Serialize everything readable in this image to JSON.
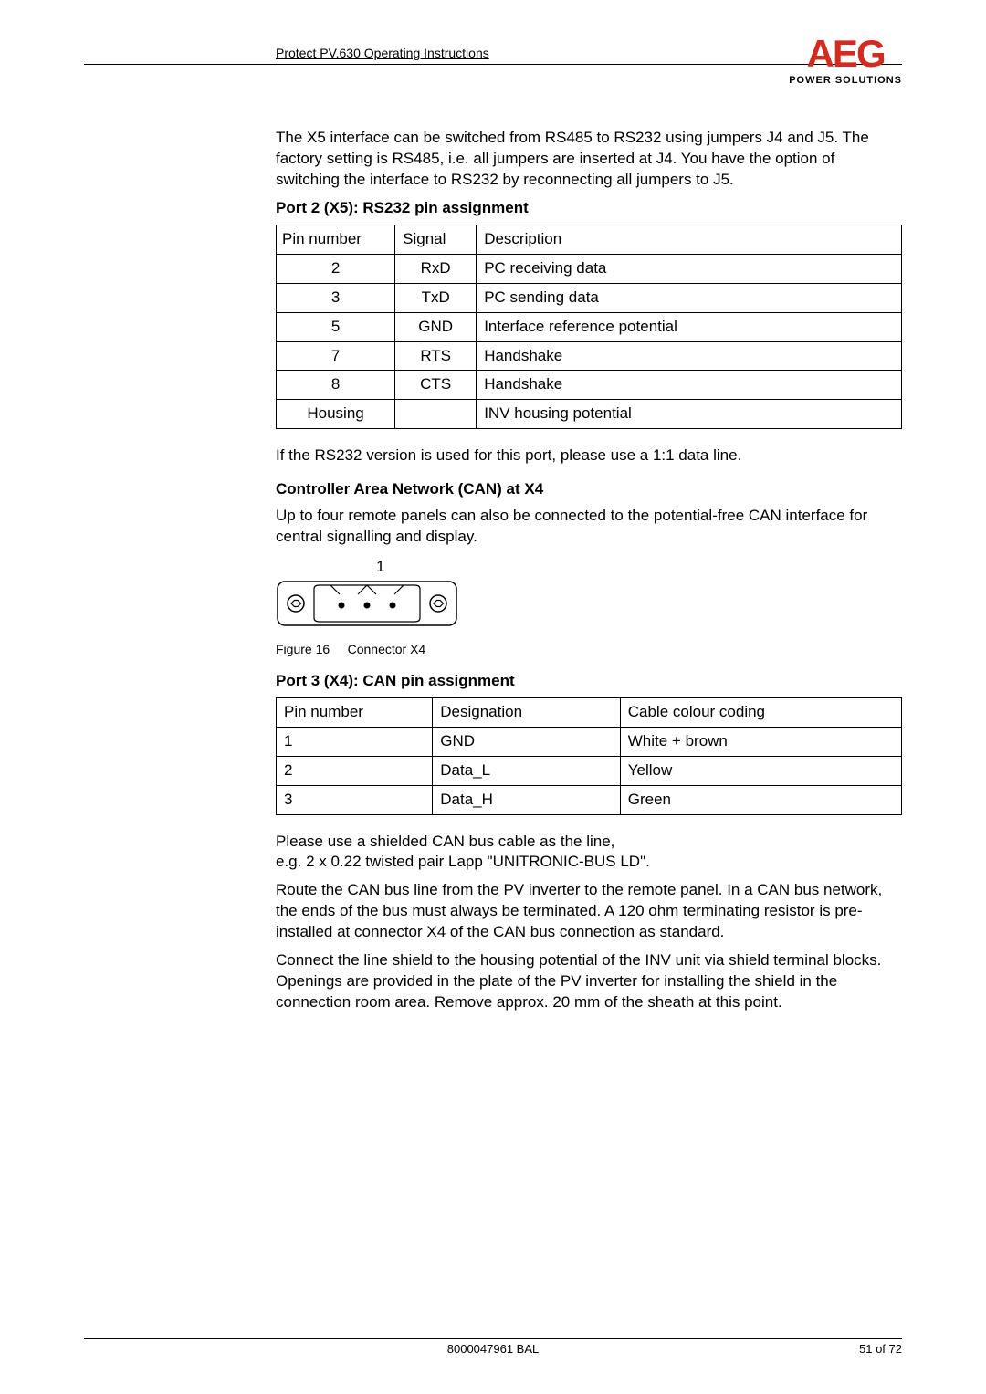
{
  "header": {
    "title": "Protect PV.630 Operating Instructions"
  },
  "logo": {
    "main": "AEG",
    "sub": "POWER SOLUTIONS"
  },
  "intro_para": "The X5 interface can be switched from RS485 to RS232 using jumpers J4 and J5. The factory setting is RS485, i.e. all jumpers are inserted at J4. You have the option of switching the interface to RS232 by reconnecting all jumpers to J5.",
  "port2_heading": "Port 2 (X5): RS232 pin assignment",
  "table1": {
    "headers": [
      "Pin number",
      "Signal",
      "Description"
    ],
    "rows": [
      [
        "2",
        "RxD",
        "PC receiving data"
      ],
      [
        "3",
        "TxD",
        "PC sending data"
      ],
      [
        "5",
        "GND",
        "Interface reference potential"
      ],
      [
        "7",
        "RTS",
        "Handshake"
      ],
      [
        "8",
        "CTS",
        "Handshake"
      ],
      [
        "Housing",
        "",
        "INV housing potential"
      ]
    ]
  },
  "rs232_note": "If the RS232 version is used for this port, please use a 1:1 data line.",
  "can_heading": "Controller Area Network (CAN) at X4",
  "can_para": "Up to four remote panels can also be connected to the potential-free CAN interface for central signalling and display.",
  "connector_label": "1",
  "fig_caption_num": "Figure 16",
  "fig_caption_text": "Connector X4",
  "port3_heading": "Port 3 (X4): CAN pin assignment",
  "table2": {
    "headers": [
      "Pin number",
      "Designation",
      "Cable colour coding"
    ],
    "rows": [
      [
        "1",
        "GND",
        "White + brown"
      ],
      [
        "2",
        "Data_L",
        "Yellow"
      ],
      [
        "3",
        "Data_H",
        "Green"
      ]
    ]
  },
  "shield_para1": "Please use a shielded CAN bus cable as the line,",
  "shield_para2": "e.g. 2 x 0.22 twisted pair Lapp \"UNITRONIC-BUS LD\".",
  "route_para": "Route the CAN bus line from the PV inverter to the remote panel. In a CAN bus network, the ends of the bus must always be terminated. A 120 ohm terminating resistor is pre-installed at connector X4 of the CAN bus connection as standard.",
  "connect_para": "Connect the line shield to the housing potential of the INV unit via shield terminal blocks. Openings are provided in the plate of the PV inverter for installing the shield in the connection room area. Remove approx. 20 mm of the sheath at this point.",
  "footer": {
    "doc": "8000047961 BAL",
    "page": "51 of 72"
  }
}
